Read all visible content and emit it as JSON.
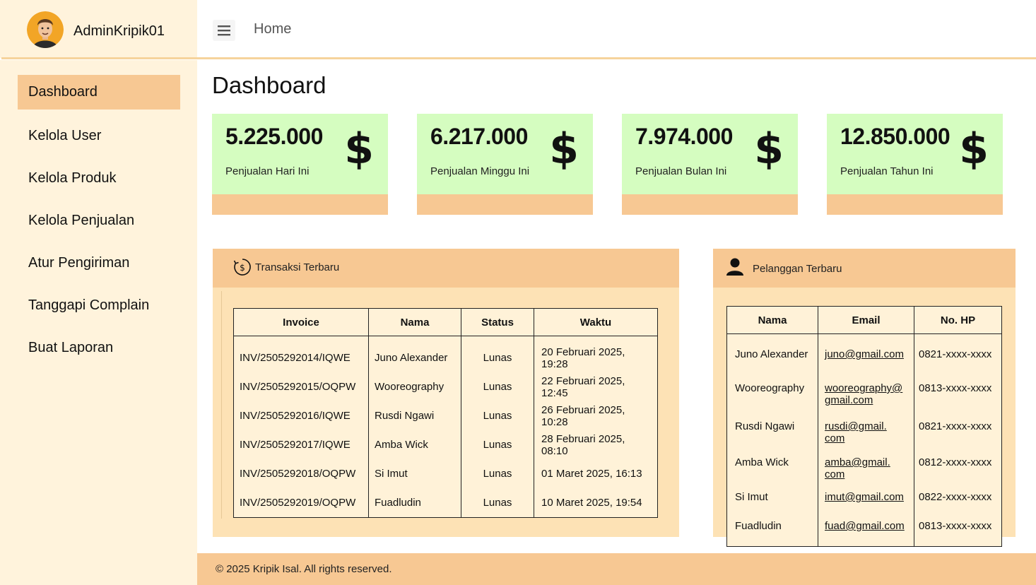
{
  "header": {
    "username": "AdminKripik01",
    "breadcrumb_home": "Home",
    "menu_icon": "hamburger-icon"
  },
  "sidebar": {
    "items": [
      {
        "label": "Dashboard",
        "active": true
      },
      {
        "label": "Kelola User",
        "active": false
      },
      {
        "label": "Kelola Produk",
        "active": false
      },
      {
        "label": "Kelola Penjualan",
        "active": false
      },
      {
        "label": "Atur Pengiriman",
        "active": false
      },
      {
        "label": "Tanggapi Complain",
        "active": false
      },
      {
        "label": "Buat Laporan",
        "active": false
      }
    ]
  },
  "main": {
    "title": "Dashboard",
    "stats": [
      {
        "value": "5.225.000",
        "label": "Penjualan Hari Ini",
        "icon": "$"
      },
      {
        "value": "6.217.000",
        "label": "Penjualan Minggu Ini",
        "icon": "$"
      },
      {
        "value": "7.974.000",
        "label": "Penjualan Bulan Ini",
        "icon": "$"
      },
      {
        "value": "12.850.000",
        "label": "Penjualan Tahun Ini",
        "icon": "$"
      }
    ],
    "transactions": {
      "title": "Transaksi Terbaru",
      "columns": [
        "Invoice",
        "Nama",
        "Status",
        "Waktu"
      ],
      "rows": [
        {
          "invoice": "INV/2505292014/IQWE",
          "nama": "Juno Alexander",
          "status": "Lunas",
          "waktu": "20 Februari 2025, 19:28"
        },
        {
          "invoice": "INV/2505292015/OQPW",
          "nama": "Wooreography",
          "status": "Lunas",
          "waktu": "22 Februari 2025, 12:45"
        },
        {
          "invoice": "INV/2505292016/IQWE",
          "nama": "Rusdi Ngawi",
          "status": "Lunas",
          "waktu": "26 Februari 2025, 10:28"
        },
        {
          "invoice": "INV/2505292017/IQWE",
          "nama": "Amba Wick",
          "status": "Lunas",
          "waktu": "28 Februari 2025, 08:10"
        },
        {
          "invoice": "INV/2505292018/OQPW",
          "nama": "Si Imut",
          "status": "Lunas",
          "waktu": "01 Maret 2025, 16:13"
        },
        {
          "invoice": "INV/2505292019/OQPW",
          "nama": "Fuadludin",
          "status": "Lunas",
          "waktu": "10 Maret 2025, 19:54"
        }
      ]
    },
    "customers": {
      "title": "Pelanggan Terbaru",
      "columns": [
        "Nama",
        "Email",
        "No. HP"
      ],
      "rows": [
        {
          "nama": "Juno Alexander",
          "email_a": "juno@gmail.com",
          "email_b": "",
          "hp": "0821-xxxx-xxxx"
        },
        {
          "nama": "Wooreography",
          "email_a": "wooreography@",
          "email_b": "gmail.com",
          "hp": "0813-xxxx-xxxx"
        },
        {
          "nama": "Rusdi Ngawi",
          "email_a": "rusdi@gmail.",
          "email_b": "com",
          "hp": "0821-xxxx-xxxx"
        },
        {
          "nama": "Amba Wick",
          "email_a": "amba@gmail.",
          "email_b": "com",
          "hp": "0812-xxxx-xxxx"
        },
        {
          "nama": "Si Imut",
          "email_a": "imut@gmail.com",
          "email_b": "",
          "hp": "0822-xxxx-xxxx"
        },
        {
          "nama": "Fuadludin",
          "email_a": "fuad@gmail.com",
          "email_b": "",
          "hp": "0813-xxxx-xxxx"
        }
      ]
    }
  },
  "footer": {
    "text": "© 2025 Kripik Isal. All rights reserved."
  },
  "colors": {
    "sidebar_bg": "#fff3dc",
    "accent": "#f7c893",
    "card_bg": "#d5fdc0",
    "panel_bg": "#fde2b5",
    "table_bg": "#fff2d8"
  }
}
